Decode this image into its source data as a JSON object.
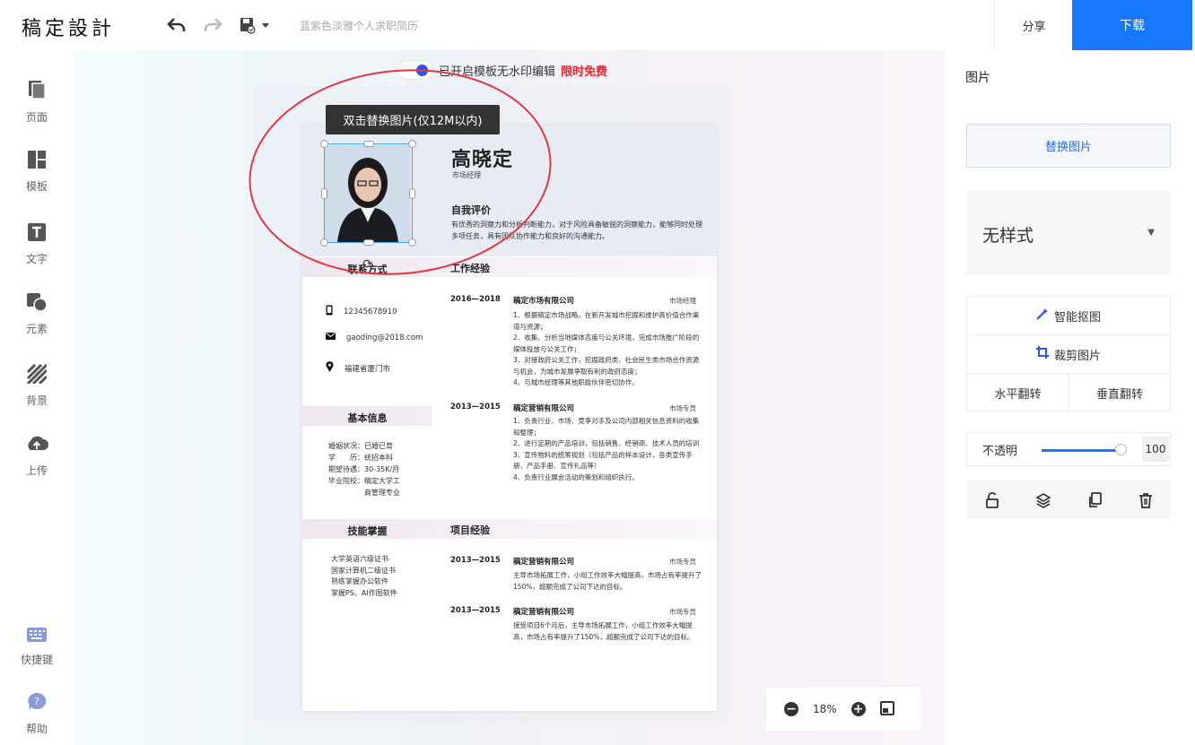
{
  "header": {
    "logo": "稿定設計",
    "doc_title": "蓝紫色淡雅个人求职简历",
    "share": "分享",
    "download": "下载"
  },
  "sidebar": {
    "items": [
      {
        "label": "页面",
        "icon": "pages-icon"
      },
      {
        "label": "模板",
        "icon": "template-icon"
      },
      {
        "label": "文字",
        "icon": "text-icon"
      },
      {
        "label": "元素",
        "icon": "element-icon"
      },
      {
        "label": "背景",
        "icon": "background-icon"
      },
      {
        "label": "上传",
        "icon": "upload-icon"
      }
    ],
    "shortcut": "快捷键",
    "help": "帮助"
  },
  "canvas": {
    "watermark_notice": "已开启模板无水印编辑",
    "free_badge": "限时免费",
    "tooltip": "双击替换图片(仅12M以内)",
    "zoom": "18%"
  },
  "resume": {
    "name": "高晓定",
    "role": "市场经理",
    "self_eval_title": "自我评价",
    "self_eval": "有优秀的洞察力和分析判断能力，对于风险具备敏锐的洞察能力，能够同时处理多项任务，具有团队协作能力和良好的沟通能力。",
    "contact_title": "联系方式",
    "phone": "12345678910",
    "email": "gaoding@2018.com",
    "address": "福建省厦门市",
    "basic_title": "基本信息",
    "basic": [
      "婚姻状况：已婚已育",
      "学　　历：统招本科",
      "期望待遇：30-35K/月",
      "毕业院校：稿定大学工",
      "　　　　　商管理专业"
    ],
    "skills_title": "技能掌握",
    "skills": [
      "大学英语六级证书",
      "国家计算机二级证书",
      "熟练掌握办公软件",
      "掌握PS、AI作图软件"
    ],
    "work_title": "工作经验",
    "work": [
      {
        "date": "2016—2018",
        "company": "稿定市场有限公司",
        "role": "市场经理",
        "desc": [
          "1、根据稿定市场战略，在新开发城市挖掘和维护高价值合作渠道与资源；",
          "2、收集、分析当地媒体态度与公关环境，完成市场推广阶段的媒体投放与公关工作；",
          "3、对接政府公关工作，挖掘政府类、社会民生类市场合作资源与机会，为城市发展争取有利的政府态度；",
          "4、与城市经理等其他职能伙伴密切协作。"
        ]
      },
      {
        "date": "2013—2015",
        "company": "稿定营销有限公司",
        "role": "市场专员",
        "desc": [
          "1、负责行业、市场、竞争对手及公司内部相关信息资料的收集和整理；",
          "2、进行定期的产品培训，包括销售、经销商、技术人员的培训",
          "3、宣传物料的统筹规划（包括产品的样本设计、各类宣传手册、产品手册、宣传礼品等）",
          "4、负责行业展会活动的策划和组织执行。"
        ]
      }
    ],
    "project_title": "项目经验",
    "projects": [
      {
        "date": "2013—2015",
        "company": "稿定营销有限公司",
        "role": "市场专员",
        "desc": "主导市场拓展工作，小组工作效率大幅提高，市场占有率提升了150%，超额完成了公司下达的目标。"
      },
      {
        "date": "2013—2015",
        "company": "稿定营销有限公司",
        "role": "市场专员",
        "desc": "接受项目6个月后，主导市场拓展工作，小组工作效率大幅提高，市场占有率提升了150%，超额完成了公司下达的目标。"
      }
    ]
  },
  "panel": {
    "title": "图片",
    "replace": "替换图片",
    "style": "无样式",
    "cutout": "智能抠图",
    "crop": "裁剪图片",
    "flip_h": "水平翻转",
    "flip_v": "垂直翻转",
    "opacity_label": "不透明",
    "opacity_value": "100",
    "opacity_level": 1.0
  },
  "colors": {
    "accent": "#1677ff",
    "free": "#f5222d",
    "annotation": "#e0383e"
  }
}
